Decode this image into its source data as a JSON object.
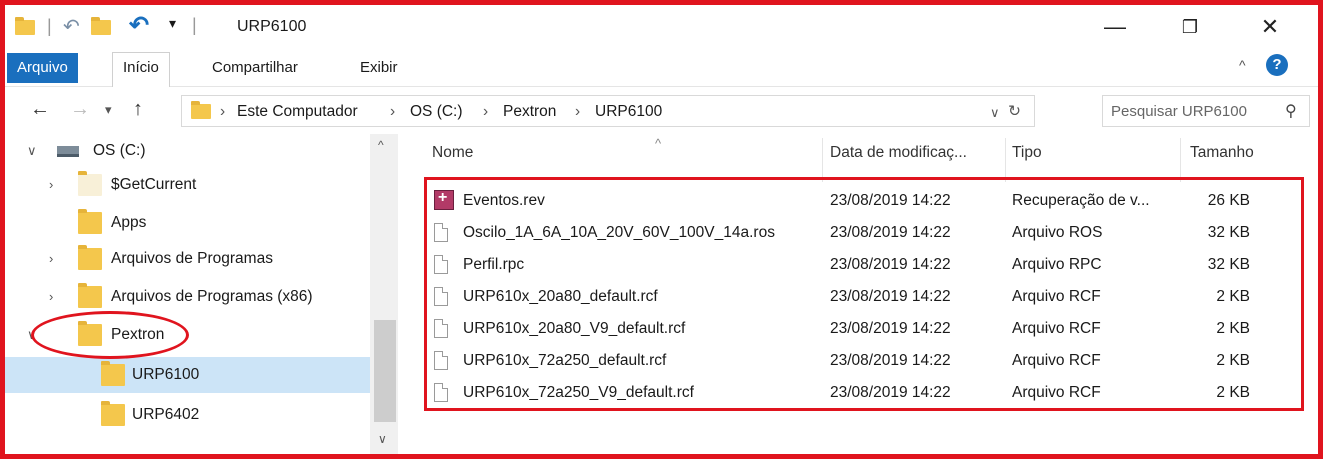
{
  "window": {
    "title": "URP6100",
    "buttons": {
      "minimize": "—",
      "restore": "❐",
      "close": "✕"
    }
  },
  "ribbon": {
    "tabs": [
      {
        "label": "Arquivo"
      },
      {
        "label": "Início"
      },
      {
        "label": "Compartilhar"
      },
      {
        "label": "Exibir"
      }
    ]
  },
  "address": {
    "crumbs": [
      "Este Computador",
      "OS (C:)",
      "Pextron",
      "URP6100"
    ],
    "search_placeholder": "Pesquisar URP6100"
  },
  "nav": {
    "items": [
      {
        "label": "OS (C:)",
        "chevron": "expanded",
        "icon": "drive-icon"
      },
      {
        "label": "$GetCurrent",
        "chevron": "collapsed",
        "icon": "folder-icon"
      },
      {
        "label": "Apps",
        "chevron": "none",
        "icon": "folder-icon"
      },
      {
        "label": "Arquivos de Programas",
        "chevron": "collapsed",
        "icon": "folder-icon"
      },
      {
        "label": "Arquivos de Programas (x86)",
        "chevron": "collapsed",
        "icon": "folder-icon"
      },
      {
        "label": "Pextron",
        "chevron": "expanded",
        "icon": "folder-icon"
      },
      {
        "label": "URP6100",
        "chevron": "none",
        "icon": "folder-icon",
        "selected": true
      },
      {
        "label": "URP6402",
        "chevron": "none",
        "icon": "folder-icon"
      }
    ]
  },
  "list": {
    "columns": [
      "Nome",
      "Data de modificaç...",
      "Tipo",
      "Tamanho"
    ],
    "rows": [
      {
        "name": "Eventos.rev",
        "date": "23/08/2019 14:22",
        "type": "Recuperação de v...",
        "size": "26 KB",
        "icon": "rev-file-icon"
      },
      {
        "name": "Oscilo_1A_6A_10A_20V_60V_100V_14a.ros",
        "date": "23/08/2019 14:22",
        "type": "Arquivo ROS",
        "size": "32 KB",
        "icon": "file-icon"
      },
      {
        "name": "Perfil.rpc",
        "date": "23/08/2019 14:22",
        "type": "Arquivo RPC",
        "size": "32 KB",
        "icon": "file-icon"
      },
      {
        "name": "URP610x_20a80_default.rcf",
        "date": "23/08/2019 14:22",
        "type": "Arquivo RCF",
        "size": "2 KB",
        "icon": "file-icon"
      },
      {
        "name": "URP610x_20a80_V9_default.rcf",
        "date": "23/08/2019 14:22",
        "type": "Arquivo RCF",
        "size": "2 KB",
        "icon": "file-icon"
      },
      {
        "name": "URP610x_72a250_default.rcf",
        "date": "23/08/2019 14:22",
        "type": "Arquivo RCF",
        "size": "2 KB",
        "icon": "file-icon"
      },
      {
        "name": "URP610x_72a250_V9_default.rcf",
        "date": "23/08/2019 14:22",
        "type": "Arquivo RCF",
        "size": "2 KB",
        "icon": "file-icon"
      }
    ]
  },
  "colors": {
    "accent": "#1a6fbe",
    "highlight": "#e0141e",
    "selection": "#cce4f7",
    "folder": "#f4c74c"
  }
}
